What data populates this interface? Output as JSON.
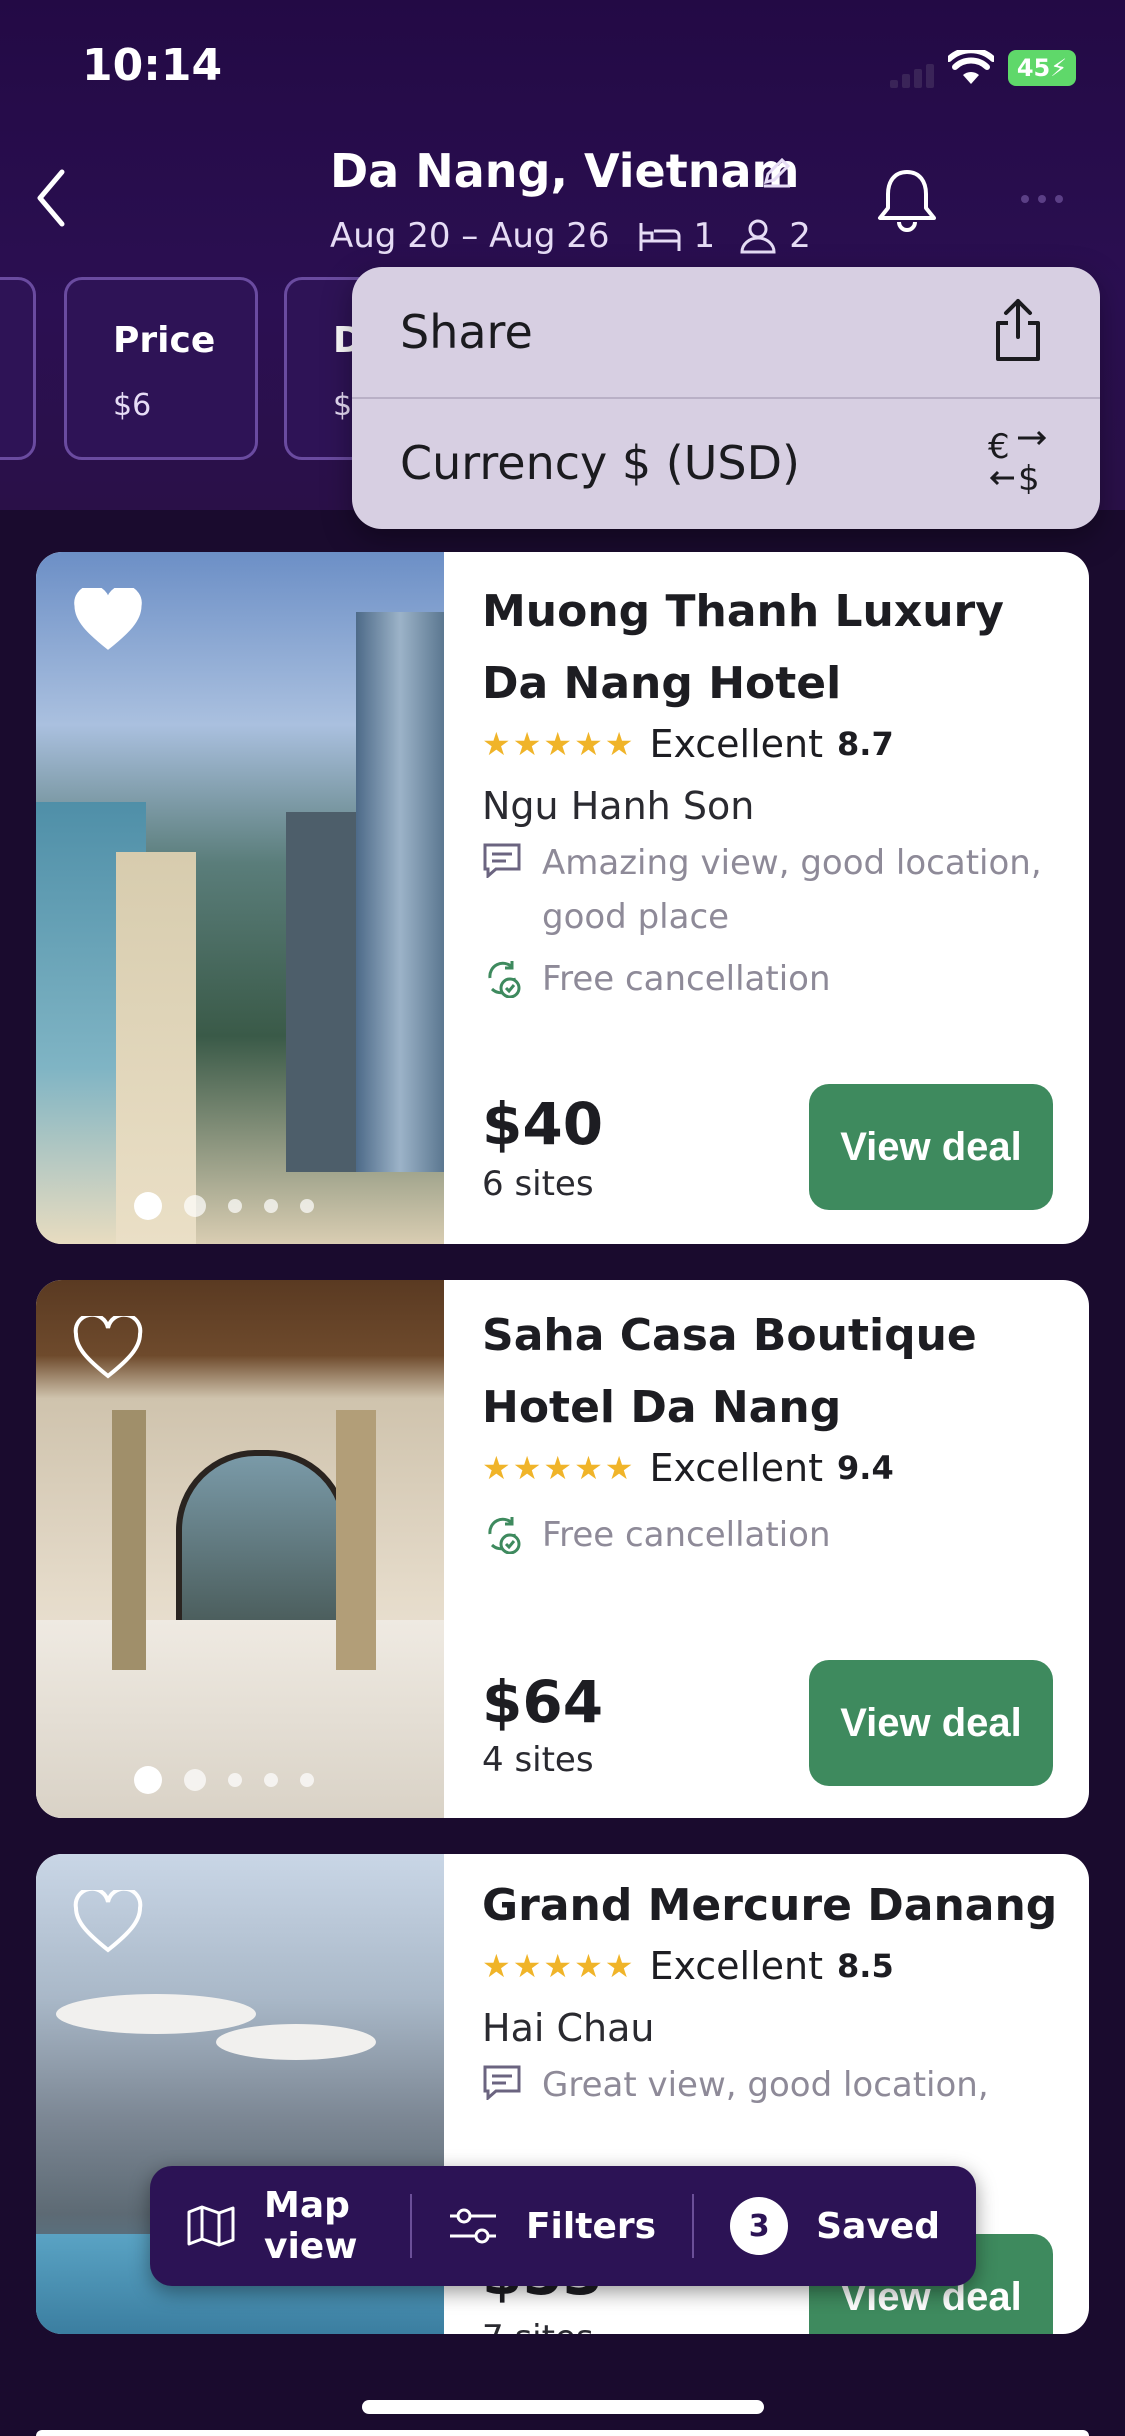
{
  "status_bar": {
    "time": "10:14",
    "battery": "45"
  },
  "header": {
    "title": "Da Nang, Vietnam",
    "dates": "Aug 20 – Aug 26",
    "rooms": "1",
    "guests": "2"
  },
  "chips": [
    {
      "title": "Price",
      "value": "$6"
    },
    {
      "title": "D",
      "value": "$"
    }
  ],
  "menu": {
    "items": [
      {
        "label": "Share",
        "icon": "share-icon"
      },
      {
        "label": "Currency $ (USD)",
        "icon": "currency-exchange-icon"
      }
    ]
  },
  "hotels": [
    {
      "name": "Muong Thanh Luxury Da Nang Hotel",
      "stars": "★★★★★",
      "rating_word": "Excellent",
      "rating": "8.7",
      "area": "Ngu Hanh Son",
      "review": "Amazing view, good location, good place",
      "cancellation": "Free cancellation",
      "price": "$40",
      "sites": "6 sites",
      "deal_label": "View deal",
      "favorited": true
    },
    {
      "name": "Saha Casa Boutique Hotel Da Nang",
      "stars": "★★★★★",
      "rating_word": "Excellent",
      "rating": "9.4",
      "cancellation": "Free cancellation",
      "price": "$64",
      "sites": "4 sites",
      "deal_label": "View deal",
      "favorited": false
    },
    {
      "name": "Grand Mercure Danang",
      "stars": "★★★★★",
      "rating_word": "Excellent",
      "rating": "8.5",
      "area": "Hai Chau",
      "review": "Great view, good location,",
      "price": "$53",
      "sites": "7 sites",
      "deal_label": "View deal",
      "favorited": false
    }
  ],
  "bottom_bar": {
    "map_label": "Map view",
    "filters_label": "Filters",
    "saved_count": "3",
    "saved_label": "Saved"
  },
  "colors": {
    "background": "#1a0b2e",
    "header": "#2b0f52",
    "menu": "#d7cfe2",
    "deal_button": "#3e8a5e",
    "star": "#f0b429"
  }
}
